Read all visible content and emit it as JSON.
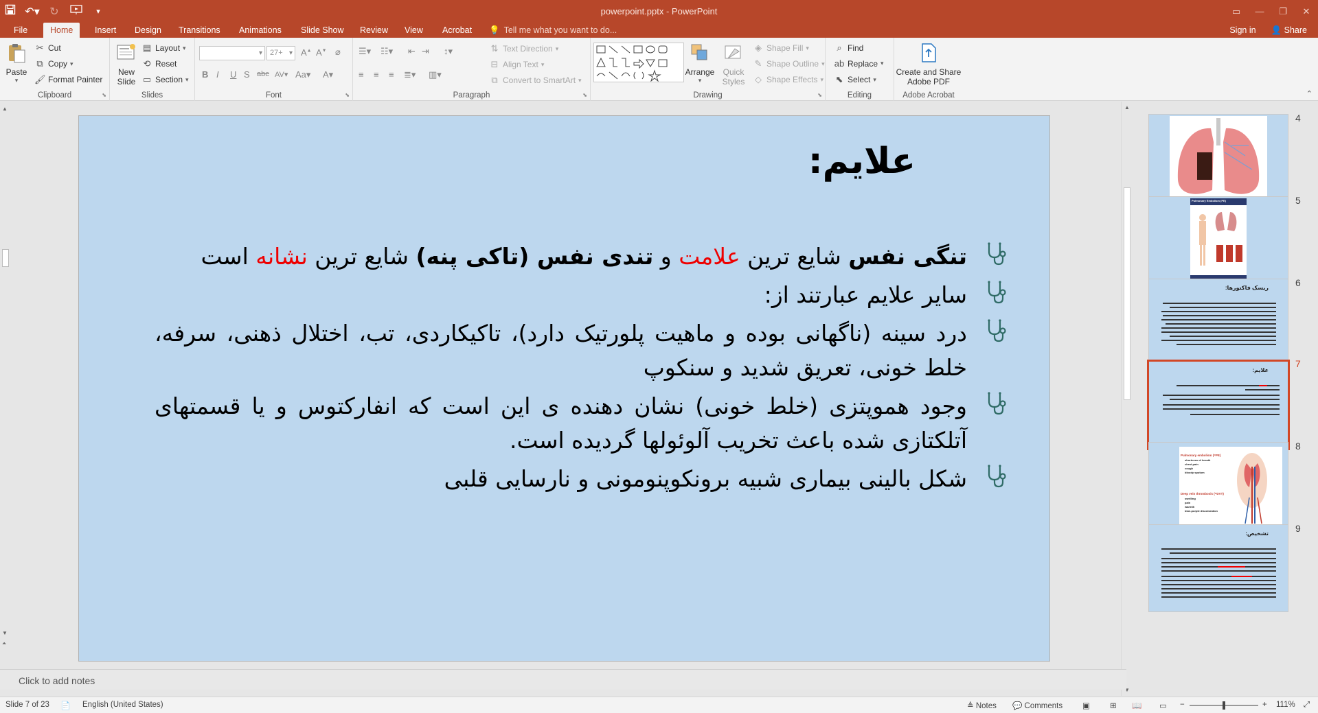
{
  "window": {
    "title": "powerpoint.pptx - PowerPoint"
  },
  "tabs": {
    "items": [
      "File",
      "Home",
      "Insert",
      "Design",
      "Transitions",
      "Animations",
      "Slide Show",
      "Review",
      "View",
      "Acrobat"
    ],
    "active": "Home",
    "tell_me": "Tell me what you want to do...",
    "sign_in": "Sign in",
    "share": "Share"
  },
  "ribbon": {
    "clipboard": {
      "label": "Clipboard",
      "paste": "Paste",
      "cut": "Cut",
      "copy": "Copy",
      "format_painter": "Format Painter"
    },
    "slides": {
      "label": "Slides",
      "new_slide_1": "New",
      "new_slide_2": "Slide",
      "layout": "Layout",
      "reset": "Reset",
      "section": "Section"
    },
    "font": {
      "label": "Font",
      "size": "27+"
    },
    "paragraph": {
      "label": "Paragraph",
      "text_direction": "Text Direction",
      "align_text": "Align Text",
      "convert_smartart": "Convert to SmartArt"
    },
    "drawing": {
      "label": "Drawing",
      "arrange": "Arrange",
      "quick_1": "Quick",
      "quick_2": "Styles",
      "shape_fill": "Shape Fill",
      "shape_outline": "Shape Outline",
      "shape_effects": "Shape Effects"
    },
    "editing": {
      "label": "Editing",
      "find": "Find",
      "replace": "Replace",
      "select": "Select"
    },
    "acrobat": {
      "label": "Adobe Acrobat",
      "create_1": "Create and Share",
      "create_2": "Adobe PDF"
    }
  },
  "slide": {
    "title": "علایم:",
    "bullets": [
      {
        "parts": [
          {
            "t": "تنگی نفس",
            "bold": true
          },
          {
            "t": " شایع ترین "
          },
          {
            "t": "علامت",
            "red": true
          },
          {
            "t": " و "
          },
          {
            "t": "تندی نفس (تاکی پنه)",
            "bold": true
          },
          {
            "t": " شایع ترین "
          },
          {
            "t": "نشانه",
            "red": true
          },
          {
            "t": " است"
          }
        ]
      },
      {
        "parts": [
          {
            "t": "سایر علایم عبارتند از:"
          }
        ]
      },
      {
        "parts": [
          {
            "t": "درد سینه (ناگهانی بوده و ماهیت پلورتیک دارد)، تاکیکاردی، تب، اختلال ذهنی، سرفه، خلط خونی، تعریق شدید و سنکوپ"
          }
        ]
      },
      {
        "parts": [
          {
            "t": "وجود هموپتزی (خلط خونی) نشان دهنده ی این است که انفارکتوس و یا قسمتهای آتلکتازی شده باعث تخریب آلوئولها گردیده است."
          }
        ]
      },
      {
        "parts": [
          {
            "t": "شکل بالینی بیماری شبیه برونکوپنومونی و نارسایی قلبی"
          }
        ]
      }
    ]
  },
  "notes_placeholder": "Click to add notes",
  "thumbnails": [
    {
      "num": "4"
    },
    {
      "num": "5",
      "heading": "Pulmonary Embolism (PE)"
    },
    {
      "num": "6",
      "heading": "ریسک فاکتورها:"
    },
    {
      "num": "7",
      "heading": "علایم:",
      "selected": true
    },
    {
      "num": "8",
      "line1": "Pulmonary embolism (=PE)",
      "items1": [
        "shortness of breath",
        "chest pain",
        "cough",
        "bloody sputum"
      ],
      "line2": "Deep vein thrombosis (=DVT)",
      "items2": [
        "swelling",
        "pain",
        "warmth",
        "blue-purple discoloration"
      ]
    },
    {
      "num": "9",
      "heading": "تشخیص:"
    }
  ],
  "status": {
    "slide_of": "Slide 7 of 23",
    "language": "English (United States)",
    "notes": "Notes",
    "comments": "Comments",
    "zoom": "111%"
  },
  "colors": {
    "accent": "#b7472a",
    "slide_bg": "#bdd7ee",
    "highlight_red": "#ee0000",
    "selected_thumb": "#d24726"
  }
}
